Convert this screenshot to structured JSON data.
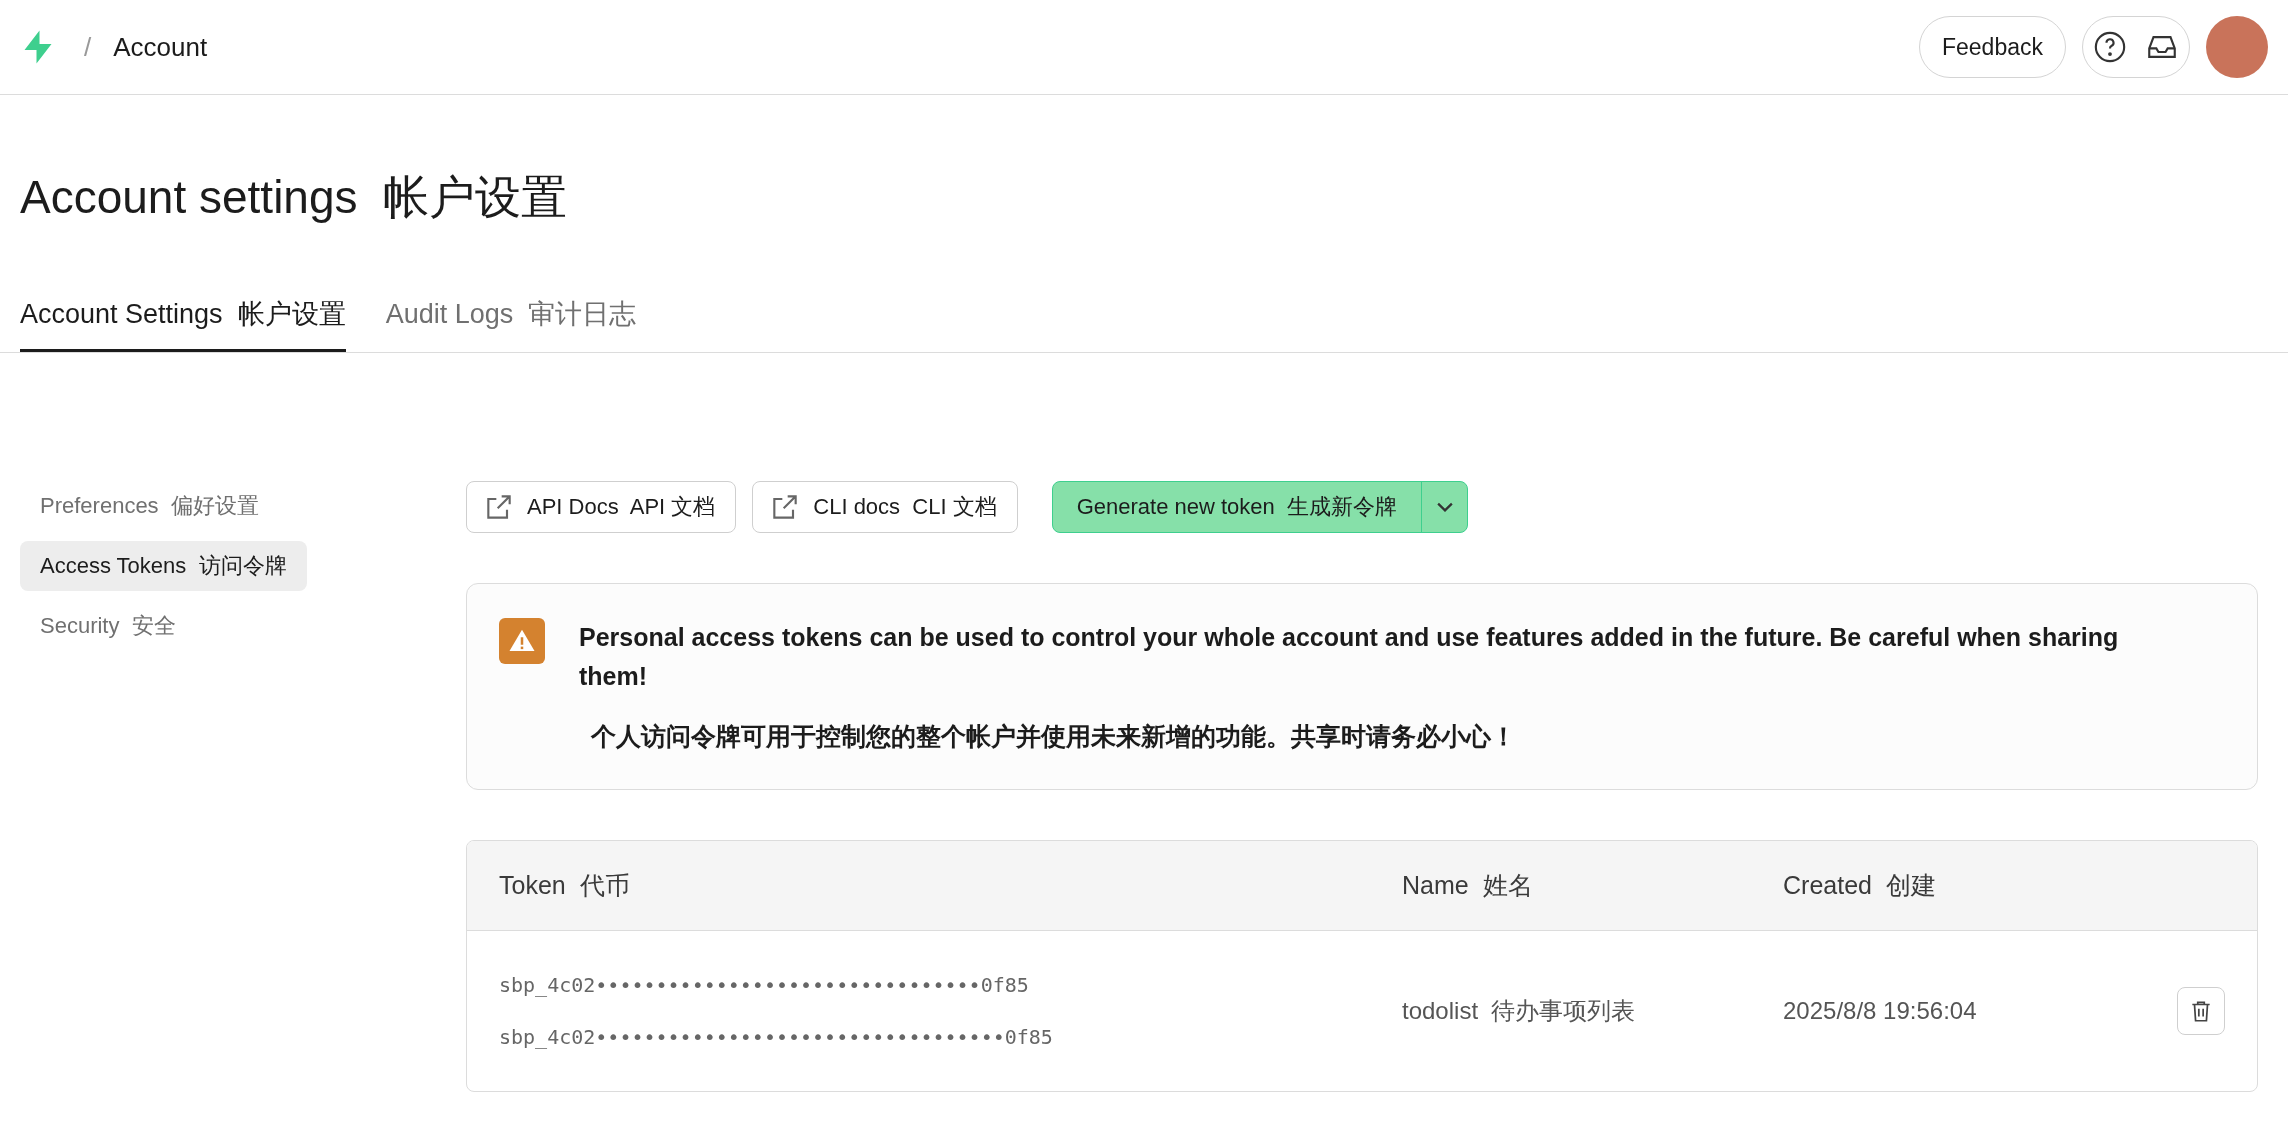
{
  "header": {
    "breadcrumb_separator": "/",
    "breadcrumb": "Account",
    "feedback_button": "Feedback"
  },
  "page_title": "Account settings  帐户设置",
  "tabs": [
    {
      "label": "Account Settings  帐户设置",
      "selected": true
    },
    {
      "label": "Audit Logs  审计日志",
      "selected": false
    }
  ],
  "sidebar": {
    "items": [
      {
        "label": "Preferences  偏好设置",
        "selected": false
      },
      {
        "label": "Access Tokens  访问令牌",
        "selected": true
      },
      {
        "label": "Security  安全",
        "selected": false
      }
    ]
  },
  "toolbar": {
    "links": [
      "API Docs  API 文档",
      "CLI docs  CLI 文档"
    ],
    "primary_button": "Generate new token  生成新令牌"
  },
  "warning": {
    "text": "Personal access tokens can be used to control your whole account and use features added in the future. Be careful when sharing them!",
    "translation": "个人访问令牌可用于控制您的整个帐户并使用未来新增的功能。共享时请务必小心！"
  },
  "table": {
    "columns": [
      "Token  代币",
      "Name  姓名",
      "Created  创建"
    ],
    "rows": [
      {
        "tokens": [
          "sbp_4c02••••••••••••••••••••••••••••••••0f85",
          "sbp_4c02••••••••••••••••••••••••••••••••••0f85"
        ],
        "name": "todolist  待办事项列表",
        "created": "2025/8/8 19:56:04"
      }
    ]
  }
}
